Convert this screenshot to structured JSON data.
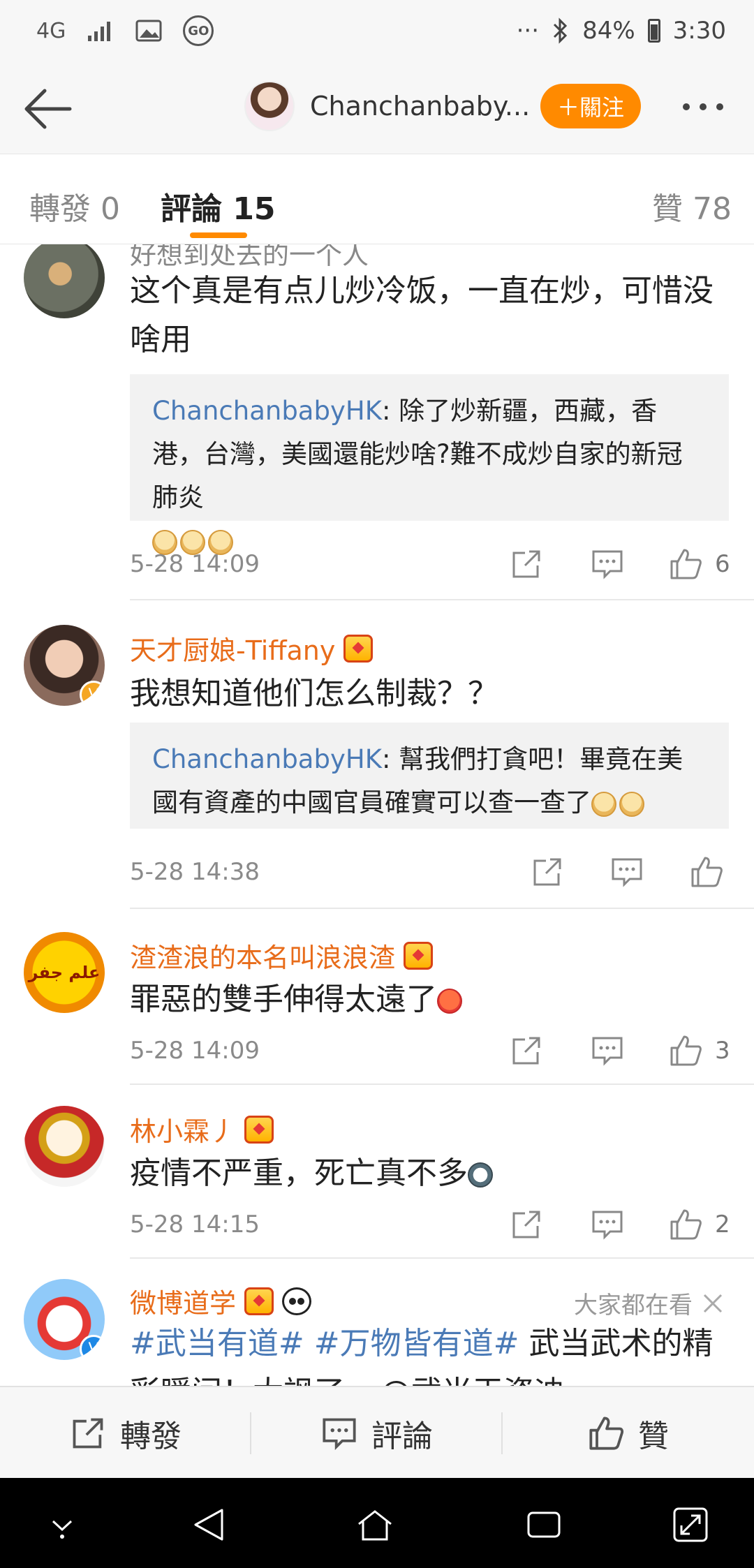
{
  "status_bar": {
    "network": "4G",
    "go_badge": "GO",
    "dots": "···",
    "battery": "84%",
    "time": "3:30"
  },
  "nav": {
    "title": "Chanchanbaby...",
    "follow_label": "＋關注"
  },
  "tabs": {
    "reposts": "轉發 0",
    "comments": "評論 15",
    "likes": "贊 78"
  },
  "comments": [
    {
      "name": "好想到处去的一个人",
      "text": "这个真是有点儿炒冷饭，一直在炒，可惜没啥用",
      "reply_name": "ChanchanbabyHK",
      "reply_text": ": 除了炒新疆，西藏，香港，台灣，美國還能炒啥?難不成炒自家的新冠肺炎",
      "time": "5-28 14:09",
      "likes": "6"
    },
    {
      "name": "天才厨娘-Tiffany",
      "text": "我想知道他们怎么制裁？？",
      "reply_name": "ChanchanbabyHK",
      "reply_text": ": 幫我們打貪吧！畢竟在美國有資產的中國官員確實可以查一查了",
      "time": "5-28 14:38",
      "likes": ""
    },
    {
      "name": "渣渣浪的本名叫浪浪渣",
      "text": "罪惡的雙手伸得太遠了",
      "avatar_text": "علم جفر",
      "time": "5-28 14:09",
      "likes": "3"
    },
    {
      "name": "林小霖丿",
      "text": "疫情不严重，死亡真不多",
      "time": "5-28 14:15",
      "likes": "2"
    },
    {
      "name": "微博道学",
      "topic1": "#武当有道#",
      "topic2": "#万物皆有道#",
      "text": " 武当武术的精彩瞬间！太飒了~ @武当王资迪",
      "watching": "大家都在看"
    }
  ],
  "bottom_bar": {
    "repost": "轉發",
    "comment": "評論",
    "like": "贊"
  },
  "colors": {
    "accent": "#ff8a00",
    "username": "#e86c1a",
    "link": "#4a7ab6"
  }
}
